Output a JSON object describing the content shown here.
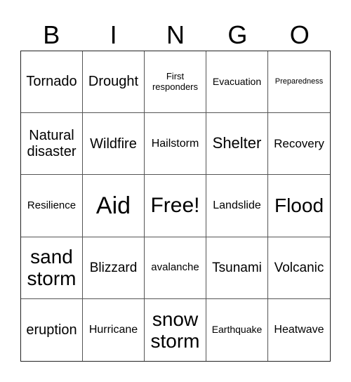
{
  "header": {
    "letters": [
      "B",
      "I",
      "N",
      "G",
      "O"
    ]
  },
  "grid": {
    "rows": [
      [
        "Tornado",
        "Drought",
        "First responders",
        "Evacuation",
        "Preparedness"
      ],
      [
        "Natural disaster",
        "Wildfire",
        "Hailstorm",
        "Shelter",
        "Recovery"
      ],
      [
        "Resilience",
        "Aid",
        "Free!",
        "Landslide",
        "Flood"
      ],
      [
        "sand storm",
        "Blizzard",
        "avalanche",
        "Tsunami",
        "Volcanic"
      ],
      [
        "eruption",
        "Hurricane",
        "snow storm",
        "Earthquake",
        "Heatwave"
      ]
    ]
  }
}
